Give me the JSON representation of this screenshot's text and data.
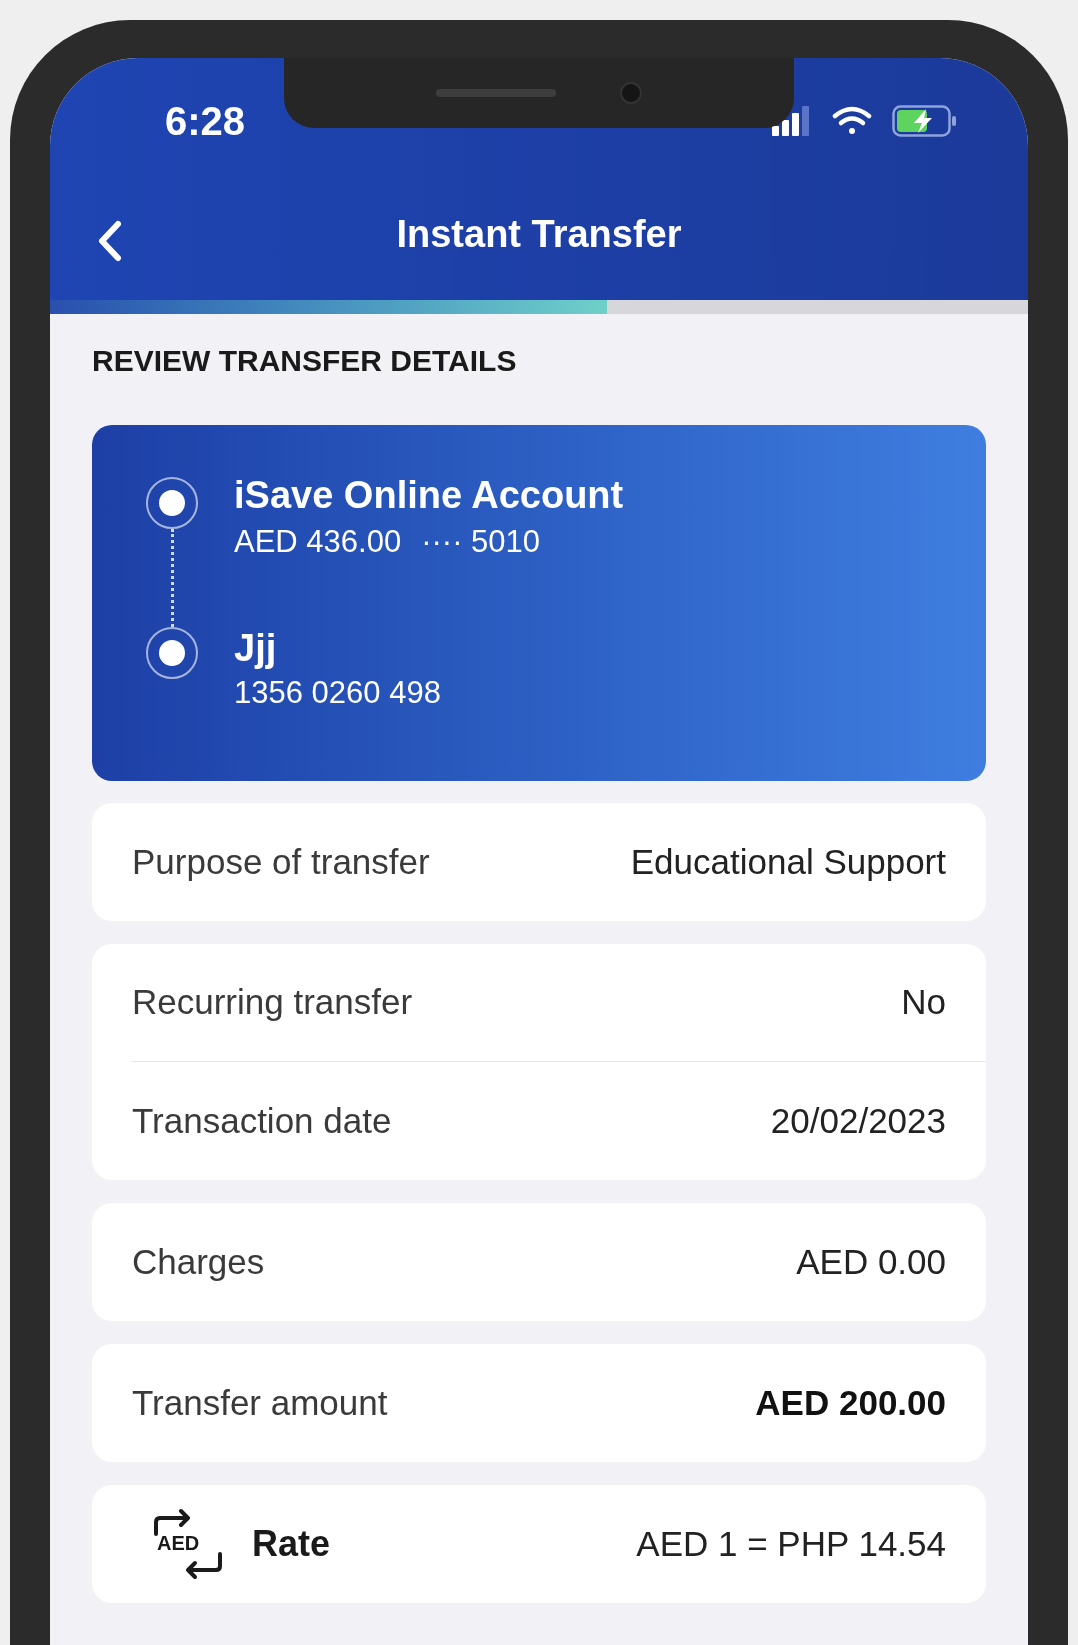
{
  "status_bar": {
    "time": "6:28"
  },
  "header": {
    "title": "Instant Transfer"
  },
  "progress": {
    "level": 0.57
  },
  "section_title": "REVIEW TRANSFER DETAILS",
  "transfer_card": {
    "from": {
      "name": "iSave Online Account",
      "balance": "AED 436.00",
      "account_mask": "···· 5010"
    },
    "to": {
      "name": "Jjj",
      "account": "1356 0260 498"
    }
  },
  "detail_groups": [
    {
      "rows": [
        {
          "kind": "plain",
          "label": "Purpose of transfer",
          "value": "Educational Support",
          "emphasis": false
        }
      ]
    },
    {
      "rows": [
        {
          "kind": "plain",
          "label": "Recurring transfer",
          "value": "No",
          "emphasis": false
        },
        {
          "kind": "plain",
          "label": "Transaction date",
          "value": "20/02/2023",
          "emphasis": false
        }
      ]
    },
    {
      "rows": [
        {
          "kind": "plain",
          "label": "Charges",
          "value": "AED 0.00",
          "emphasis": false
        }
      ]
    },
    {
      "rows": [
        {
          "kind": "plain",
          "label": "Transfer amount",
          "value": "AED 200.00",
          "emphasis": true
        }
      ]
    },
    {
      "rows": [
        {
          "kind": "rate",
          "icon_text": "AED",
          "label": "Rate",
          "value": "AED 1 = PHP 14.54",
          "emphasis": false
        }
      ]
    }
  ]
}
